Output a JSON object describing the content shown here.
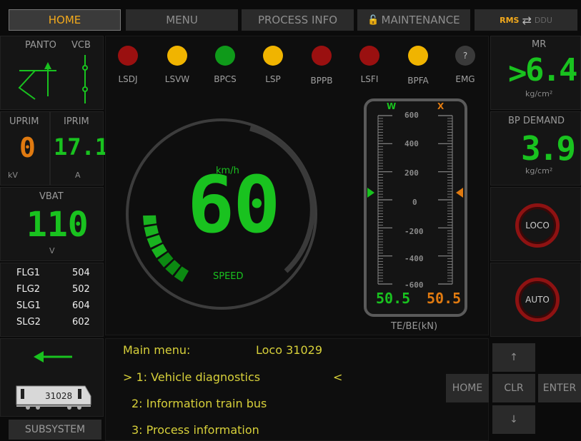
{
  "tabs": {
    "home": "HOME",
    "menu": "MENU",
    "process_info": "PROCESS INFO",
    "maintenance": "MAINTENANCE",
    "rms": "RMS",
    "ddu": "DDU"
  },
  "panto": {
    "panto_label": "PANTO",
    "vcb_label": "VCB"
  },
  "uprim": {
    "label": "UPRIM",
    "value": "0",
    "unit": "kV"
  },
  "iprim": {
    "label": "IPRIM",
    "value": "17.1",
    "unit": "A"
  },
  "vbat": {
    "label": "VBAT",
    "value": "110",
    "unit": "V"
  },
  "flags": [
    {
      "name": "FLG1",
      "value": "504"
    },
    {
      "name": "FLG2",
      "value": "502"
    },
    {
      "name": "SLG1",
      "value": "604"
    },
    {
      "name": "SLG2",
      "value": "602"
    }
  ],
  "lamps": [
    {
      "name": "LSDJ",
      "color": "#9a1010"
    },
    {
      "name": "LSVW",
      "color": "#f0b400"
    },
    {
      "name": "BPCS",
      "color": "#0f9a1a"
    },
    {
      "name": "LSP",
      "color": "#f0b400"
    },
    {
      "name": "BPPB",
      "color": "#9a1010"
    },
    {
      "name": "LSFI",
      "color": "#9a1010"
    },
    {
      "name": "BPFA",
      "color": "#f0b400"
    },
    {
      "name": "EMG",
      "color": "#3a3a3a",
      "symbol": "?"
    }
  ],
  "speed": {
    "unit": "km/h",
    "value": "60",
    "label": "SPEED",
    "level": 0.6
  },
  "tebe": {
    "w_label": "W",
    "x_label": "X",
    "ticks": [
      "600",
      "400",
      "200",
      "0",
      "-200",
      "-400",
      "-600"
    ],
    "left_value": "50.5",
    "right_value": "50.5",
    "caption": "TE/BE(kN)"
  },
  "mr": {
    "label": "MR",
    "value": "6.4",
    "unit": "kg/cm²"
  },
  "bp_demand": {
    "label": "BP DEMAND",
    "value": "3.9",
    "unit": "kg/cm²"
  },
  "loco_button": "LOCO",
  "auto_button": "AUTO",
  "loco_number": "31028",
  "subsystem": "SUBSYSTEM",
  "menu": {
    "title": "Main menu:",
    "loco": "Loco 31029",
    "items": [
      "> 1: Vehicle diagnostics",
      "2: Information train bus",
      "3: Process information"
    ],
    "cursor_end": "<"
  },
  "keys": {
    "up": "↑",
    "down": "↓",
    "home": "HOME",
    "clr": "CLR",
    "enter": "ENTER"
  },
  "colors": {
    "accent": "#f2a91c",
    "green": "#19c21f",
    "orange": "#e07a10",
    "yellow": "#d7d03a",
    "red": "#b01515"
  }
}
